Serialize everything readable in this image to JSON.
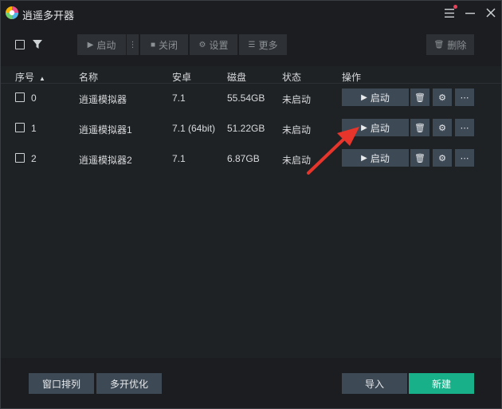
{
  "app": {
    "title": "逍遥多开器"
  },
  "toolbar": {
    "start_label": "启动",
    "close_label": "关闭",
    "settings_label": "设置",
    "more_label": "更多",
    "delete_label": "删除"
  },
  "table": {
    "headers": {
      "index": "序号",
      "name": "名称",
      "android": "安卓",
      "disk": "磁盘",
      "status": "状态",
      "actions": "操作"
    },
    "rows": [
      {
        "index": "0",
        "name": "逍遥模拟器",
        "android": "7.1",
        "disk": "55.54GB",
        "status": "未启动",
        "start_label": "启动"
      },
      {
        "index": "1",
        "name": "逍遥模拟器1",
        "android": "7.1 (64bit)",
        "disk": "51.22GB",
        "status": "未启动",
        "start_label": "启动"
      },
      {
        "index": "2",
        "name": "逍遥模拟器2",
        "android": "7.1",
        "disk": "6.87GB",
        "status": "未启动",
        "start_label": "启动"
      }
    ]
  },
  "footer": {
    "arrange_label": "窗口排列",
    "optimize_label": "多开优化",
    "import_label": "导入",
    "new_label": "新建"
  },
  "colors": {
    "accent": "#17b089",
    "button_bg": "#3d4a56",
    "annotation_arrow": "#e8352b"
  }
}
